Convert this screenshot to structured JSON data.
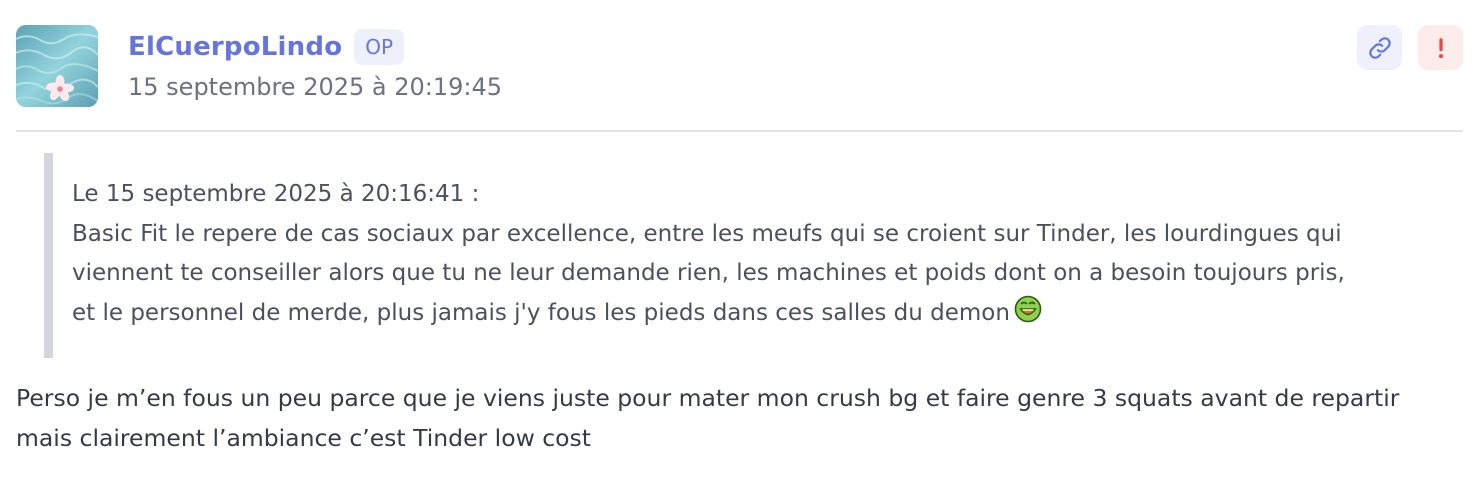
{
  "post": {
    "author": "ElCuerpoLindo",
    "badge": "OP",
    "timestamp": "15 septembre 2025 à 20:19:45",
    "actions": [
      {
        "icon": "link-icon",
        "color": "#6675dd"
      },
      {
        "icon": "exclamation-icon",
        "color": "#e5484d"
      }
    ],
    "quote": {
      "header": "Le 15 septembre 2025 à 20:16:41 :",
      "lines": [
        "Basic Fit le repere de cas sociaux par excellence, entre les meufs qui se croient sur Tinder, les lourdingues qui",
        "viennent te conseiller alors que tu ne leur demande rien, les machines et poids dont on a besoin toujours pris,",
        "et le personnel de merde, plus jamais j'y fous les pieds dans ces salles du demon"
      ],
      "emoji": "green-laughing-smiley-icon"
    },
    "body": [
      "Perso je m’en fous un peu parce que je viens juste pour mater mon crush bg et faire genre 3 squats avant de repartir",
      "mais clairement l’ambiance c’est Tinder low cost"
    ]
  }
}
